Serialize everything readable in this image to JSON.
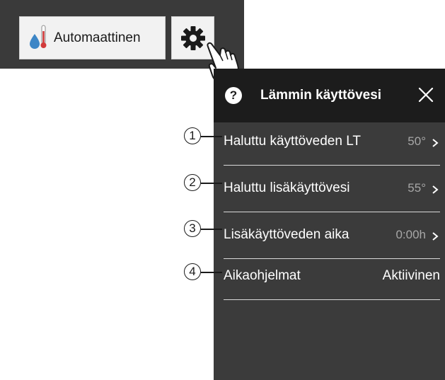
{
  "topbar": {
    "mode_button": {
      "label": "Automaattinen",
      "icon": "water-thermometer-icon"
    },
    "settings_button": {
      "icon": "gear-icon"
    }
  },
  "panel": {
    "title": "Lämmin käyttövesi",
    "help_icon": "?",
    "rows": [
      {
        "callout": "1",
        "label": "Haluttu käyttöveden LT",
        "value": "50°"
      },
      {
        "callout": "2",
        "label": "Haluttu lisäkäyttövesi",
        "value": "55°"
      },
      {
        "callout": "3",
        "label": "Lisäkäyttöveden aika",
        "value": "0:00h"
      },
      {
        "callout": "4",
        "label": "Aikaohjelmat",
        "value": "Aktiivinen"
      }
    ]
  },
  "colors": {
    "topbar_bg": "#3a3a3a",
    "panel_bg": "#3b3b3b",
    "header_bg": "#1c1c1c",
    "value_gray": "#a7a7a7",
    "drop_blue": "#3d86c6",
    "thermo_red": "#d23b3b"
  }
}
